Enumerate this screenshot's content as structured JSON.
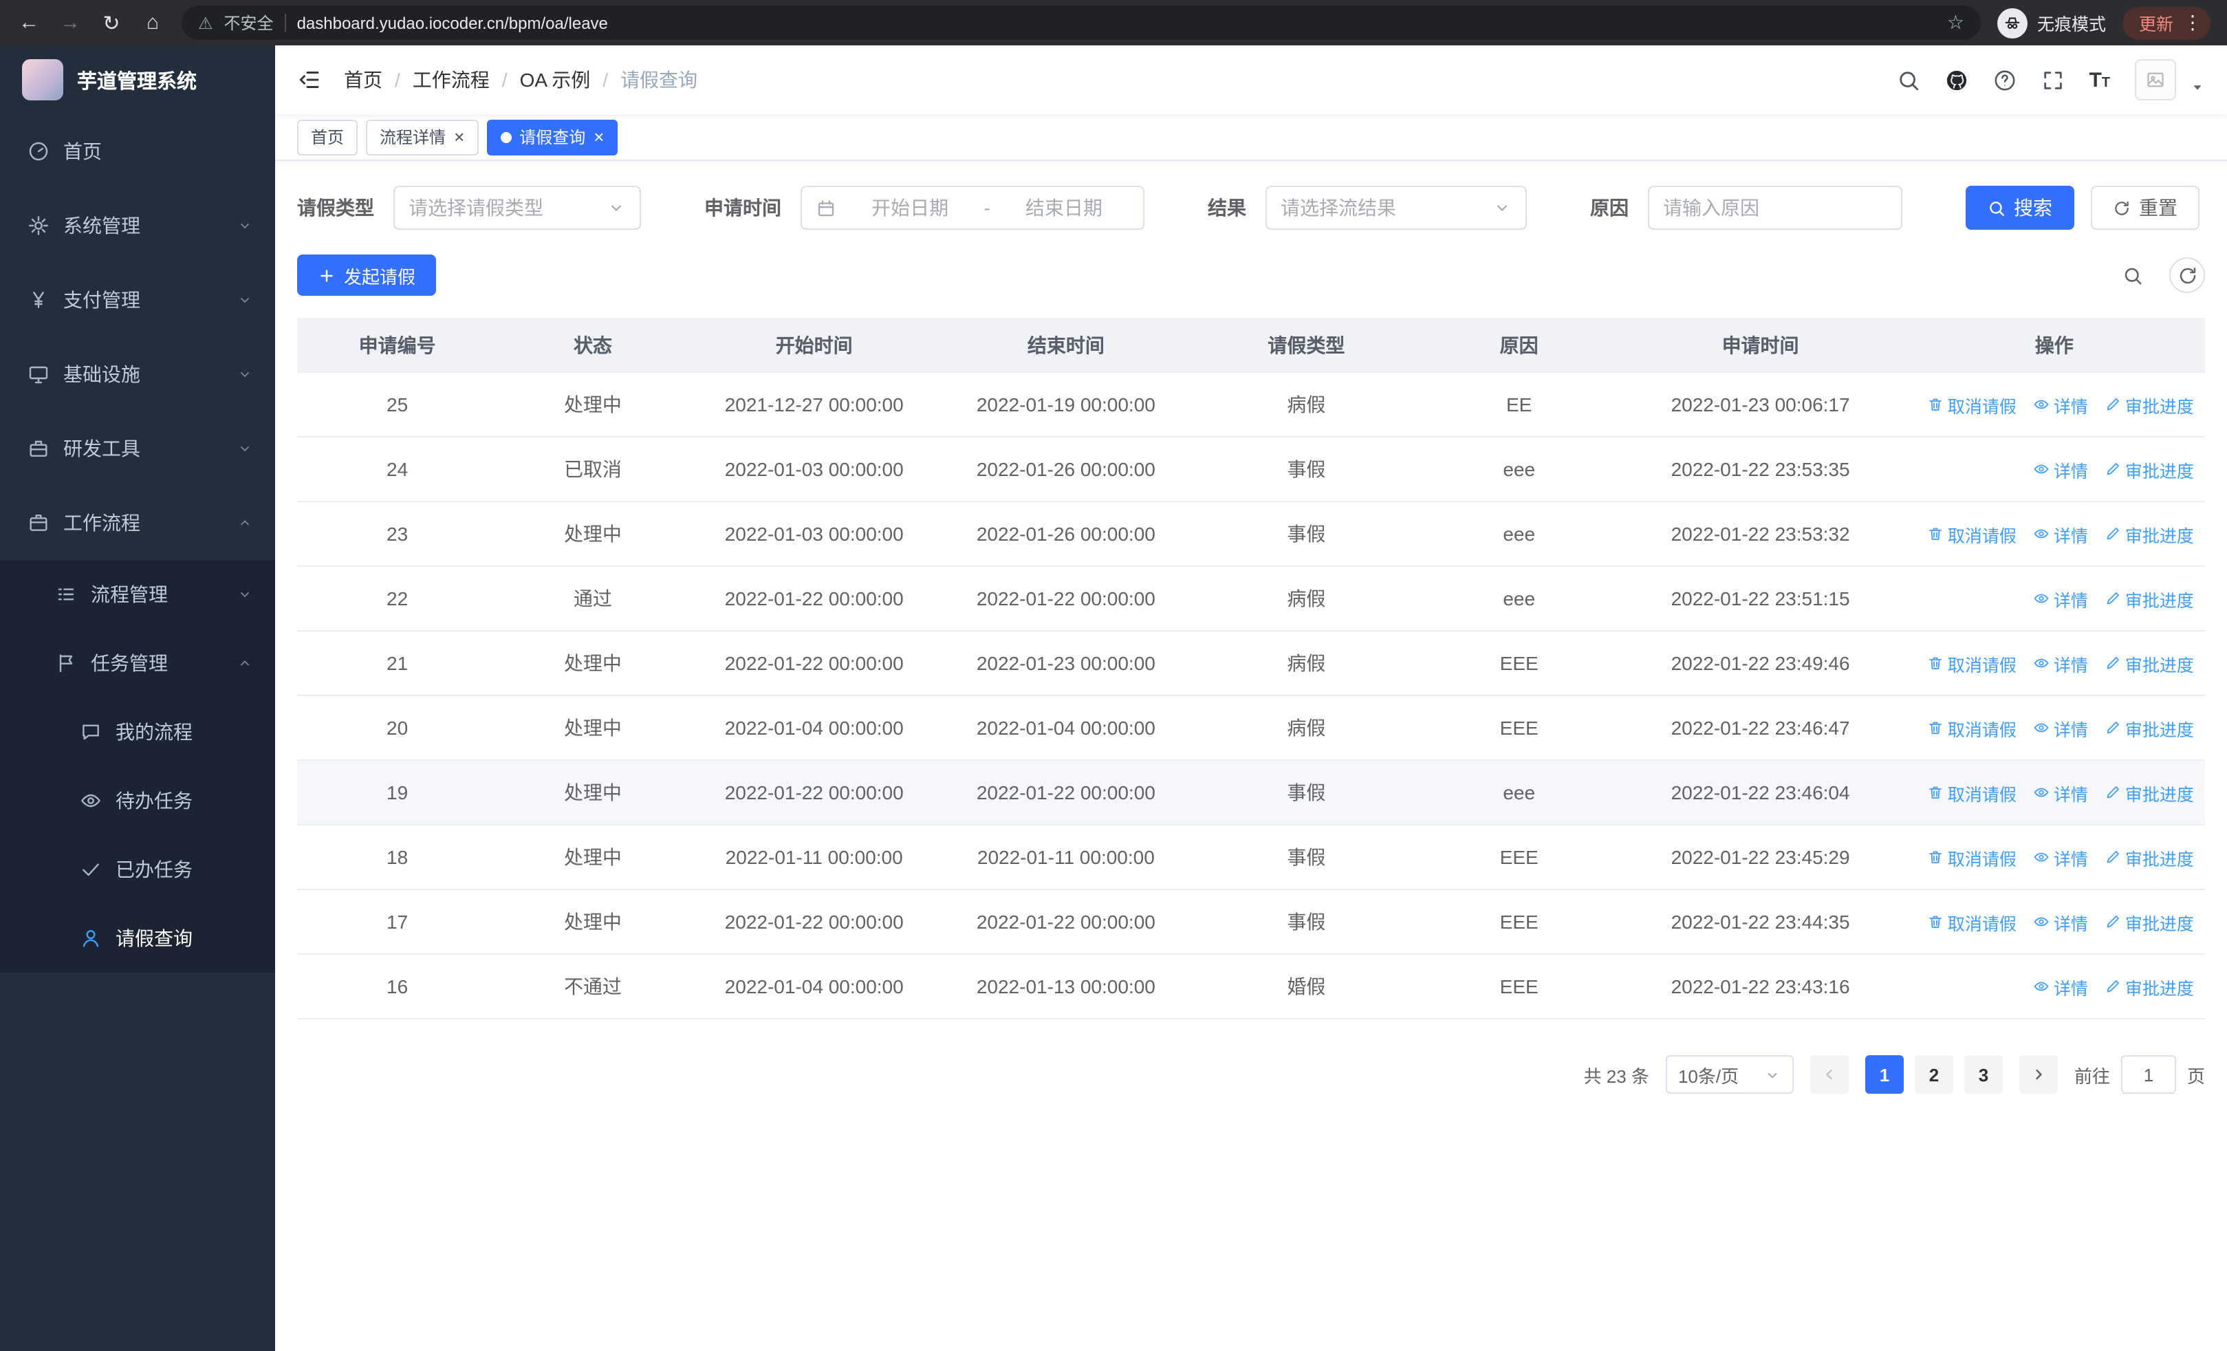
{
  "colors": {
    "primary": "#3370ff",
    "link": "#409eff"
  },
  "browser": {
    "security_label": "不安全",
    "url": "dashboard.yudao.iocoder.cn/bpm/oa/leave",
    "incognito_label": "无痕模式",
    "update_label": "更新"
  },
  "sidebar": {
    "title": "芋道管理系统",
    "menu": [
      {
        "label": "首页",
        "icon": "dashboard-icon",
        "level": 1
      },
      {
        "label": "系统管理",
        "icon": "gear-icon",
        "level": 1,
        "chevron": "down"
      },
      {
        "label": "支付管理",
        "icon": "yen-icon",
        "level": 1,
        "chevron": "down"
      },
      {
        "label": "基础设施",
        "icon": "infrastructure-icon",
        "level": 1,
        "chevron": "down"
      },
      {
        "label": "研发工具",
        "icon": "toolbox-icon",
        "level": 1,
        "chevron": "down"
      },
      {
        "label": "工作流程",
        "icon": "workflow-icon",
        "level": 1,
        "chevron": "up"
      },
      {
        "label": "流程管理",
        "icon": "process-list-icon",
        "level": 2,
        "chevron": "down"
      },
      {
        "label": "任务管理",
        "icon": "task-flag-icon",
        "level": 2,
        "chevron": "up"
      },
      {
        "label": "我的流程",
        "icon": "chat-icon",
        "level": 3
      },
      {
        "label": "待办任务",
        "icon": "eye-icon",
        "level": 3
      },
      {
        "label": "已办任务",
        "icon": "check-icon",
        "level": 3
      },
      {
        "label": "请假查询",
        "icon": "user-icon",
        "level": 3,
        "active": true
      }
    ]
  },
  "header": {
    "breadcrumb": [
      "首页",
      "工作流程",
      "OA 示例",
      "请假查询"
    ]
  },
  "tabs": [
    {
      "label": "首页",
      "active": false,
      "closable": false
    },
    {
      "label": "流程详情",
      "active": false,
      "closable": true
    },
    {
      "label": "请假查询",
      "active": true,
      "closable": true
    }
  ],
  "filters": {
    "leave_type_label": "请假类型",
    "leave_type_placeholder": "请选择请假类型",
    "apply_time_label": "申请时间",
    "start_date_placeholder": "开始日期",
    "range_separator": "-",
    "end_date_placeholder": "结束日期",
    "result_label": "结果",
    "result_placeholder": "请选择流结果",
    "reason_label": "原因",
    "reason_placeholder": "请输入原因",
    "search_label": "搜索",
    "reset_label": "重置"
  },
  "toolbar": {
    "create_label": "发起请假"
  },
  "table": {
    "columns": [
      "申请编号",
      "状态",
      "开始时间",
      "结束时间",
      "请假类型",
      "原因",
      "申请时间",
      "操作"
    ],
    "action_labels": {
      "cancel": "取消请假",
      "detail": "详情",
      "progress": "审批进度"
    },
    "rows": [
      {
        "id": "25",
        "status": "处理中",
        "start": "2021-12-27 00:00:00",
        "end": "2022-01-19 00:00:00",
        "type": "病假",
        "reason": "EE",
        "applied": "2022-01-23 00:06:17",
        "actions": [
          "cancel",
          "detail",
          "progress"
        ],
        "highlighted": false
      },
      {
        "id": "24",
        "status": "已取消",
        "start": "2022-01-03 00:00:00",
        "end": "2022-01-26 00:00:00",
        "type": "事假",
        "reason": "eee",
        "applied": "2022-01-22 23:53:35",
        "actions": [
          "detail",
          "progress"
        ],
        "highlighted": false
      },
      {
        "id": "23",
        "status": "处理中",
        "start": "2022-01-03 00:00:00",
        "end": "2022-01-26 00:00:00",
        "type": "事假",
        "reason": "eee",
        "applied": "2022-01-22 23:53:32",
        "actions": [
          "cancel",
          "detail",
          "progress"
        ],
        "highlighted": false
      },
      {
        "id": "22",
        "status": "通过",
        "start": "2022-01-22 00:00:00",
        "end": "2022-01-22 00:00:00",
        "type": "病假",
        "reason": "eee",
        "applied": "2022-01-22 23:51:15",
        "actions": [
          "detail",
          "progress"
        ],
        "highlighted": false
      },
      {
        "id": "21",
        "status": "处理中",
        "start": "2022-01-22 00:00:00",
        "end": "2022-01-23 00:00:00",
        "type": "病假",
        "reason": "EEE",
        "applied": "2022-01-22 23:49:46",
        "actions": [
          "cancel",
          "detail",
          "progress"
        ],
        "highlighted": false
      },
      {
        "id": "20",
        "status": "处理中",
        "start": "2022-01-04 00:00:00",
        "end": "2022-01-04 00:00:00",
        "type": "病假",
        "reason": "EEE",
        "applied": "2022-01-22 23:46:47",
        "actions": [
          "cancel",
          "detail",
          "progress"
        ],
        "highlighted": false
      },
      {
        "id": "19",
        "status": "处理中",
        "start": "2022-01-22 00:00:00",
        "end": "2022-01-22 00:00:00",
        "type": "事假",
        "reason": "eee",
        "applied": "2022-01-22 23:46:04",
        "actions": [
          "cancel",
          "detail",
          "progress"
        ],
        "highlighted": true
      },
      {
        "id": "18",
        "status": "处理中",
        "start": "2022-01-11 00:00:00",
        "end": "2022-01-11 00:00:00",
        "type": "事假",
        "reason": "EEE",
        "applied": "2022-01-22 23:45:29",
        "actions": [
          "cancel",
          "detail",
          "progress"
        ],
        "highlighted": false
      },
      {
        "id": "17",
        "status": "处理中",
        "start": "2022-01-22 00:00:00",
        "end": "2022-01-22 00:00:00",
        "type": "事假",
        "reason": "EEE",
        "applied": "2022-01-22 23:44:35",
        "actions": [
          "cancel",
          "detail",
          "progress"
        ],
        "highlighted": false
      },
      {
        "id": "16",
        "status": "不通过",
        "start": "2022-01-04 00:00:00",
        "end": "2022-01-13 00:00:00",
        "type": "婚假",
        "reason": "EEE",
        "applied": "2022-01-22 23:43:16",
        "actions": [
          "detail",
          "progress"
        ],
        "highlighted": false
      }
    ]
  },
  "pagination": {
    "total_label": "共 23 条",
    "page_size_label": "10条/页",
    "pages": [
      "1",
      "2",
      "3"
    ],
    "current_page": "1",
    "goto_label": "前往",
    "goto_value": "1",
    "goto_unit": "页"
  }
}
